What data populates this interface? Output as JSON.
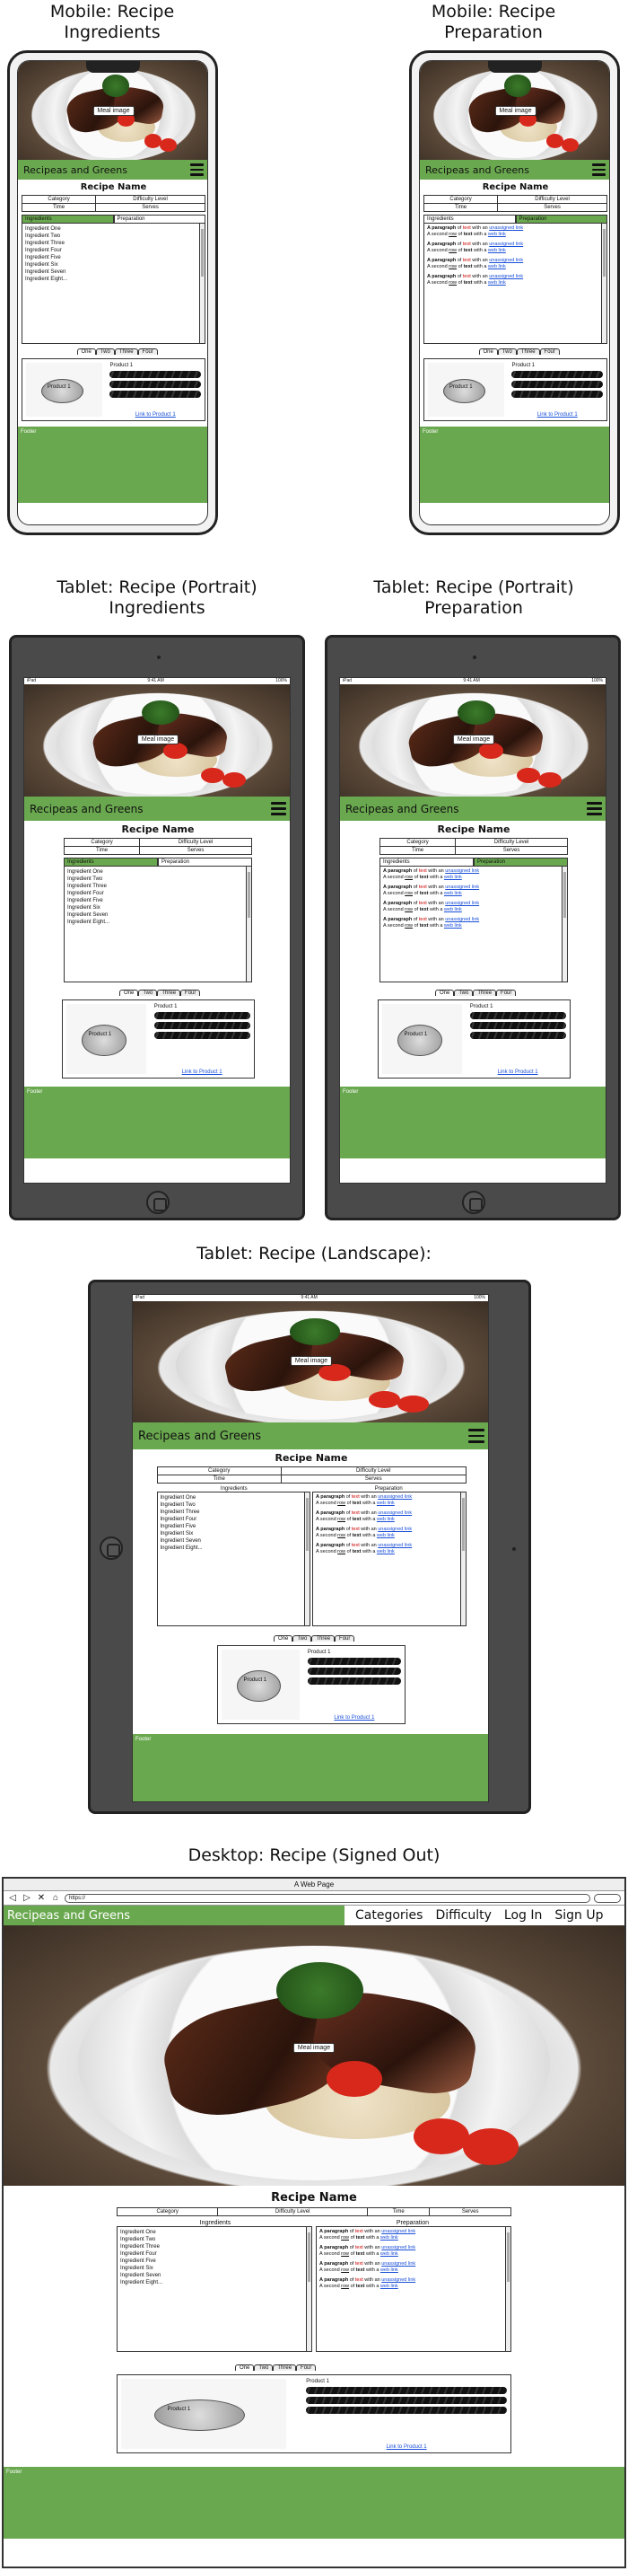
{
  "sections": {
    "mobile_ingredients": "Mobile: Recipe\nIngredients",
    "mobile_preparation": "Mobile: Recipe\nPreparation",
    "tablet_portrait_ingredients": "Tablet: Recipe (Portrait)\nIngredients",
    "tablet_portrait_preparation": "Tablet: Recipe (Portrait)\nPreparation",
    "tablet_landscape": "Tablet: Recipe (Landscape):",
    "desktop": "Desktop: Recipe (Signed Out)"
  },
  "meal_image_label": "Meal image",
  "brand": "Recipeas and Greens",
  "recipe_name": "Recipe Name",
  "info": {
    "category": "Category",
    "difficulty": "Difficulty Level",
    "time": "Time",
    "serves": "Serves"
  },
  "tabs": {
    "ingredients": "Ingredients",
    "preparation": "Preparation"
  },
  "ingredients": [
    "Ingredient One",
    "Ingredient Two",
    "Ingredient Three",
    "Ingredient Four",
    "Ingredient Five",
    "Ingredient Six",
    "Ingredient Seven",
    "Ingredient Eight..."
  ],
  "paragraph": {
    "a": "paragraph",
    "b": " of ",
    "c": "text",
    "d": " with an ",
    "e": "unassigned link",
    "f": "A second ",
    "g": "row",
    "h": " of ",
    "i": "text",
    "j": " with a ",
    "k": "web link"
  },
  "product": {
    "tabs": [
      "One",
      "Two",
      "Three",
      "Four"
    ],
    "title": "Product 1",
    "image_label": "Product 1",
    "link": "Link to Product 1"
  },
  "footer": "Footer",
  "tablet_status": {
    "left": "iPad",
    "center": "9:41 AM",
    "right": "100%"
  },
  "desktop": {
    "window_title": "A Web Page",
    "url": "https://",
    "nav": [
      "Categories",
      "Difficulty",
      "Log In",
      "Sign Up"
    ]
  },
  "colors": {
    "green": "#6aa84f",
    "link": "#1a4fd8"
  }
}
